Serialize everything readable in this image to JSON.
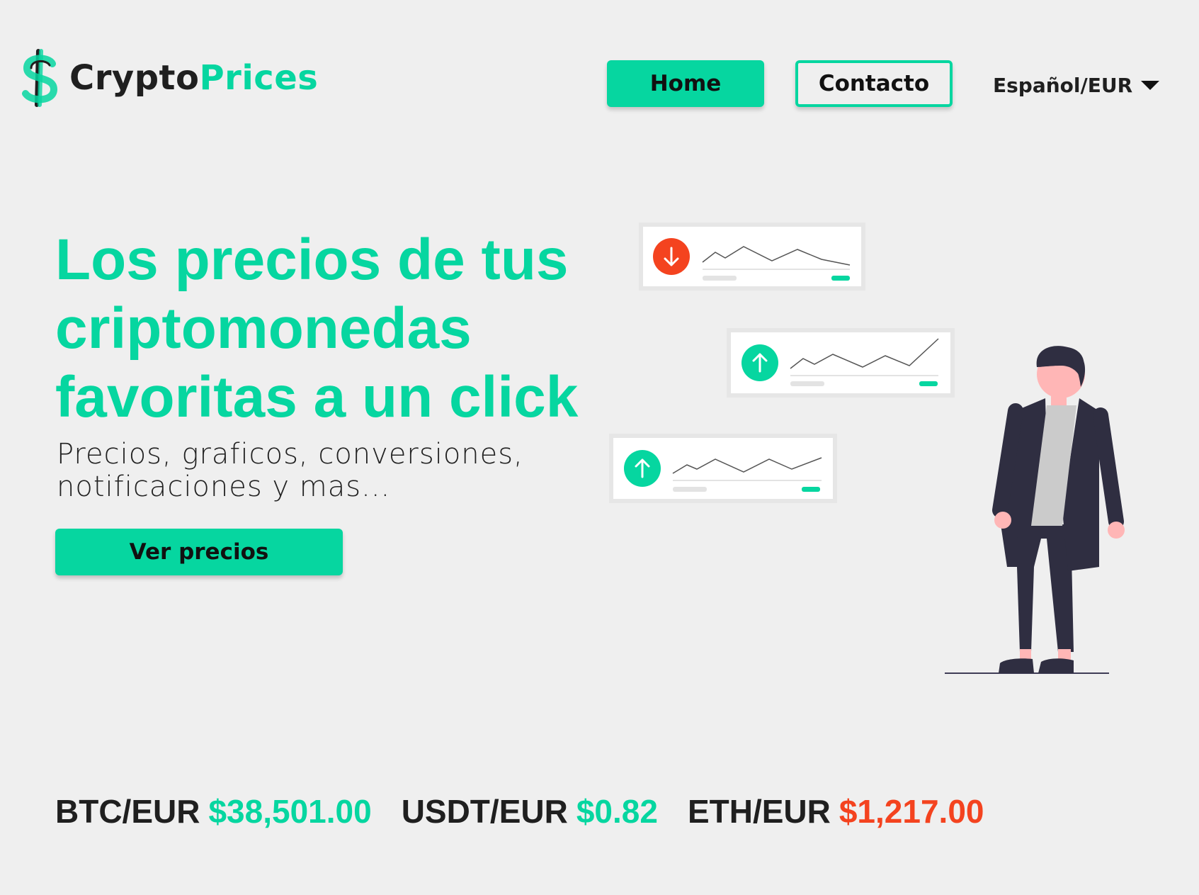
{
  "brand": {
    "name_part1": "Crypto",
    "name_part2": "Prices",
    "logo_icon": "dollar-icon",
    "accent_color": "#06d6a0"
  },
  "nav": {
    "home_label": "Home",
    "contact_label": "Contacto",
    "language_label": "Español/EUR",
    "language_icon": "caret-down-icon"
  },
  "hero": {
    "title": "Los precios de tus criptomonedas favoritas a un click",
    "subtitle": "Precios, graficos, conversiones, notificaciones y mas...",
    "cta_label": "Ver precios"
  },
  "illustration": {
    "cards": [
      {
        "trend": "down",
        "icon": "arrow-down-icon",
        "color": "#f4431f"
      },
      {
        "trend": "up",
        "icon": "arrow-up-icon",
        "color": "#06d6a0"
      },
      {
        "trend": "up",
        "icon": "arrow-up-icon",
        "color": "#06d6a0"
      }
    ],
    "person": "person-standing-illustration"
  },
  "ticker": [
    {
      "pair": "BTC/EUR",
      "price": "$38,501.00",
      "trend": "up"
    },
    {
      "pair": "USDT/EUR",
      "price": "$0.82",
      "trend": "up"
    },
    {
      "pair": "ETH/EUR",
      "price": "$1,217.00",
      "trend": "down"
    }
  ],
  "colors": {
    "up": "#06d6a0",
    "down": "#f4431f",
    "background": "#efefef"
  }
}
